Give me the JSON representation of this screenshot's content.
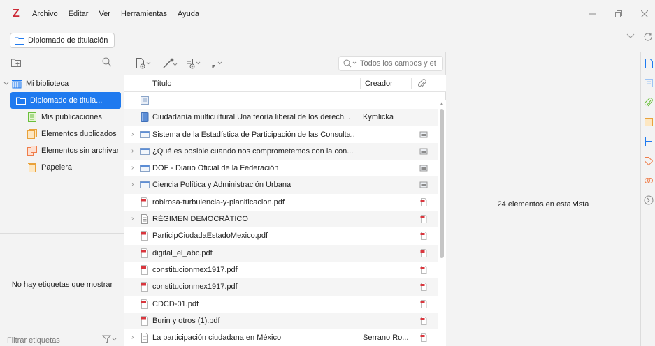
{
  "app": {
    "logo": "Z"
  },
  "menu": [
    "Archivo",
    "Editar",
    "Ver",
    "Herramientas",
    "Ayuda"
  ],
  "window_controls": [
    "minimize-icon",
    "restore-icon",
    "close-icon"
  ],
  "collection_tab": {
    "label": "Diplomado de titulación"
  },
  "left_pane": {
    "tree": [
      {
        "label": "Mi biblioteca",
        "icon": "library-icon",
        "expanded": true
      },
      {
        "label": "Diplomado de titula...",
        "icon": "folder-icon",
        "selected": true
      },
      {
        "label": "Mis publicaciones",
        "icon": "publications-icon"
      },
      {
        "label": "Elementos duplicados",
        "icon": "duplicates-icon"
      },
      {
        "label": "Elementos sin archivar",
        "icon": "unfiled-icon"
      },
      {
        "label": "Papelera",
        "icon": "trash-icon"
      }
    ],
    "no_tags": "No hay etiquetas que mostrar",
    "tag_filter_placeholder": "Filtrar etiquetas"
  },
  "items_pane": {
    "search_placeholder": "Todos los campos y et",
    "columns": {
      "title": "Título",
      "creator": "Creador"
    },
    "rows": [
      {
        "title": "",
        "creator": "",
        "icon": "note",
        "expandable": false,
        "attachment": ""
      },
      {
        "title": "Ciudadanía multicultural Una teoría liberal de los derech...",
        "creator": "Kymlicka",
        "icon": "book",
        "expandable": false,
        "attachment": ""
      },
      {
        "title": "Sistema de la Estadística de Participación de las Consulta...",
        "creator": "",
        "icon": "webpage",
        "expandable": true,
        "attachment": "snapshot"
      },
      {
        "title": "¿Qué es posible cuando nos comprometemos con la con...",
        "creator": "",
        "icon": "webpage",
        "expandable": true,
        "attachment": "snapshot"
      },
      {
        "title": "DOF - Diario Oficial de la Federación",
        "creator": "",
        "icon": "webpage",
        "expandable": true,
        "attachment": "snapshot"
      },
      {
        "title": "Ciencia Política y Administración Urbana",
        "creator": "",
        "icon": "webpage",
        "expandable": true,
        "attachment": "snapshot"
      },
      {
        "title": "robirosa-turbulencia-y-planificacion.pdf",
        "creator": "",
        "icon": "pdf",
        "expandable": false,
        "attachment": "pdf"
      },
      {
        "title": "RÉGIMEN DEMOCRÁTICO",
        "creator": "",
        "icon": "document",
        "expandable": true,
        "attachment": "pdf"
      },
      {
        "title": "ParticipCiudadaEstadoMexico.pdf",
        "creator": "",
        "icon": "pdf",
        "expandable": false,
        "attachment": "pdf"
      },
      {
        "title": "digital_el_abc.pdf",
        "creator": "",
        "icon": "pdf",
        "expandable": false,
        "attachment": "pdf"
      },
      {
        "title": "constitucionmex1917.pdf",
        "creator": "",
        "icon": "pdf",
        "expandable": false,
        "attachment": "pdf"
      },
      {
        "title": "constitucionmex1917.pdf",
        "creator": "",
        "icon": "pdf",
        "expandable": false,
        "attachment": "pdf"
      },
      {
        "title": "CDCD-01.pdf",
        "creator": "",
        "icon": "pdf",
        "expandable": false,
        "attachment": "pdf"
      },
      {
        "title": "Burin y otros (1).pdf",
        "creator": "",
        "icon": "pdf",
        "expandable": false,
        "attachment": "pdf"
      },
      {
        "title": "La participación ciudadana en México",
        "creator": "Serrano Ro...",
        "icon": "document",
        "expandable": true,
        "attachment": "pdf"
      }
    ]
  },
  "item_pane": {
    "count_text": "24 elementos en esta vista"
  },
  "colors": {
    "accent": "#1f7aef",
    "logo": "#cc2936",
    "pdf": "#d9363e",
    "background": "#f3f3f3"
  }
}
